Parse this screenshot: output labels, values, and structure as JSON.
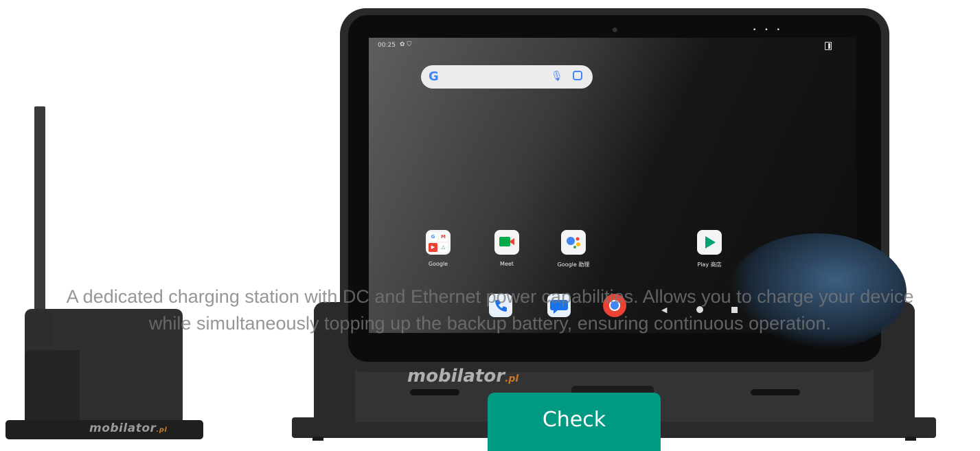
{
  "caption": {
    "line1": "A dedicated charging station with DC and Ethernet power capabilities. Allows you to charge your device",
    "line2": "while simultaneously topping up the backup battery, ensuring continuous operation."
  },
  "cta": {
    "label": "Check"
  },
  "brand": {
    "logo_main": "mobilator",
    "logo_suffix": ".pl"
  },
  "tablet_screen": {
    "status_time": "00:25",
    "search_logo": "G",
    "apps": [
      {
        "label": "Google",
        "icon": "google-folder-icon"
      },
      {
        "label": "Meet",
        "icon": "meet-icon"
      },
      {
        "label": "Google 助理",
        "icon": "assistant-icon"
      },
      {
        "label": "Play 商店",
        "icon": "play-store-icon"
      }
    ],
    "google_folder_tiles": [
      "G",
      "M",
      "▶",
      "△"
    ]
  },
  "colors": {
    "cta": "#009982",
    "brand_accent": "#c8782a"
  }
}
